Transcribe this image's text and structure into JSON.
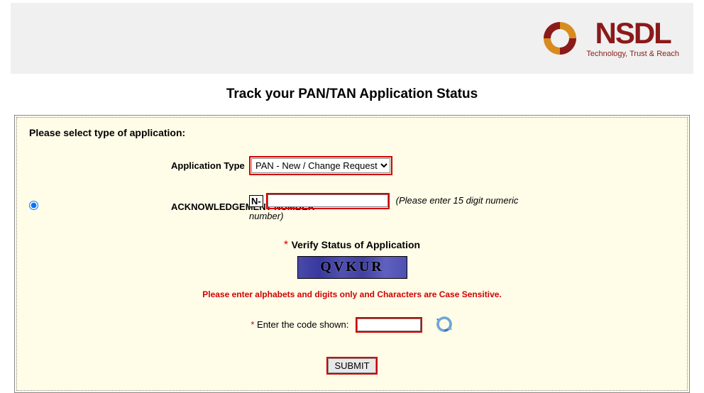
{
  "header": {
    "logo_main": "NSDL",
    "logo_tagline": "Technology, Trust & Reach"
  },
  "page": {
    "title": "Track your PAN/TAN Application Status"
  },
  "form": {
    "instruction": "Please select type of application:",
    "app_type_label": "Application Type",
    "app_type_selected": "PAN - New / Change Request",
    "ack_label": "ACKNOWLEDGEMENT NUMBER",
    "ack_prefix": "N-",
    "ack_hint_part1": "(Please enter 15 digit numeric",
    "ack_hint_part2": "number)",
    "captcha_label": "Verify Status of Application",
    "captcha_value": "QVKUR",
    "captcha_hint": "Please enter alphabets and digits only and Characters are Case Sensitive.",
    "code_label": "Enter the code shown:",
    "submit_label": "SUBMIT"
  }
}
